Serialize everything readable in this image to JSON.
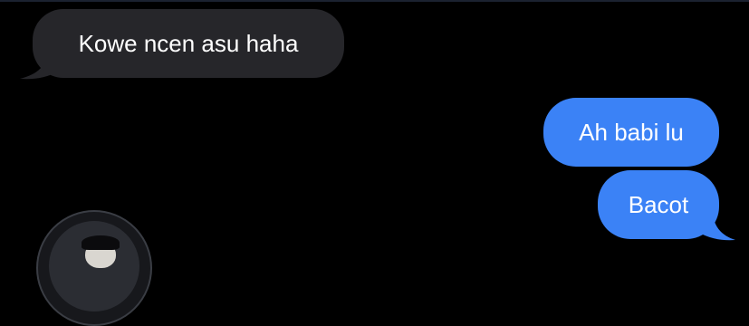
{
  "conversation": {
    "messages": [
      {
        "direction": "incoming",
        "text": "Kowe ncen asu haha"
      },
      {
        "direction": "outgoing",
        "text": "Ah babi lu"
      },
      {
        "direction": "outgoing",
        "text": "Bacot"
      }
    ]
  },
  "colors": {
    "background": "#000000",
    "incoming_bubble": "#26262a",
    "outgoing_bubble": "#3b82f6",
    "text": "#ffffff"
  },
  "icons": {
    "avatar": "contact-avatar-icon"
  }
}
